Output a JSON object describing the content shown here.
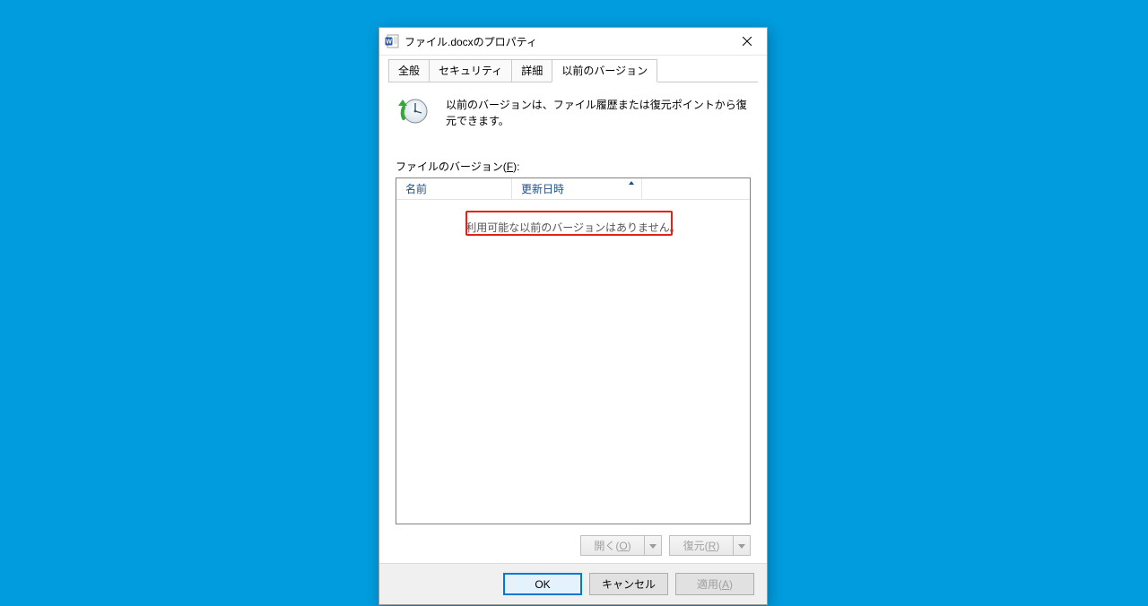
{
  "window": {
    "title": "ファイル.docxのプロパティ"
  },
  "tabs": {
    "general": "全般",
    "security": "セキュリティ",
    "details": "詳細",
    "previous": "以前のバージョン"
  },
  "description": "以前のバージョンは、ファイル履歴または復元ポイントから復元できます。",
  "section_label_prefix": "ファイルのバージョン(",
  "section_label_key": "F",
  "section_label_suffix": "):",
  "columns": {
    "name": "名前",
    "date": "更新日時"
  },
  "empty_message": "利用可能な以前のバージョンはありません。",
  "actions": {
    "open_prefix": "開く(",
    "open_key": "O",
    "open_suffix": ")",
    "restore_prefix": "復元(",
    "restore_key": "R",
    "restore_suffix": ")"
  },
  "buttons": {
    "ok": "OK",
    "cancel": "キャンセル",
    "apply_prefix": "適用(",
    "apply_key": "A",
    "apply_suffix": ")"
  }
}
